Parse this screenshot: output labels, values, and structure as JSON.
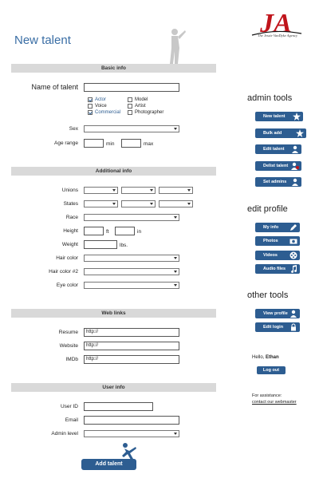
{
  "page": {
    "title": "New talent"
  },
  "logo": {
    "monogram": "JA",
    "tagline": "The Jessie VanDyke Agency"
  },
  "sections": {
    "basic": "Basic info",
    "additional": "Additional info",
    "web": "Web links",
    "user": "User info"
  },
  "basic": {
    "name_label": "Name of talent",
    "roles": [
      {
        "label": "Actor",
        "checked": true
      },
      {
        "label": "Model",
        "checked": false
      },
      {
        "label": "Voice",
        "checked": false
      },
      {
        "label": "Artist",
        "checked": false
      },
      {
        "label": "Commercial",
        "checked": true
      },
      {
        "label": "Photographer",
        "checked": false
      }
    ],
    "sex_label": "Sex",
    "age_label": "Age range",
    "age_min": "min",
    "age_max": "max"
  },
  "additional": {
    "unions": "Unions",
    "states": "States",
    "race": "Race",
    "height": "Height",
    "height_ft": "ft",
    "height_in": "in",
    "weight": "Weight",
    "weight_unit": "lbs.",
    "hair": "Hair color",
    "hair2": "Hair color #2",
    "eye": "Eye color"
  },
  "web": {
    "resume": "Resume",
    "website": "Website",
    "imdb": "IMDb",
    "prefix": "http://"
  },
  "user": {
    "userid": "User ID",
    "email": "Email",
    "admin": "Admin level"
  },
  "submit": "Add talent",
  "sidebar": {
    "admin_heading": "admin tools",
    "admin_buttons": [
      "New talent",
      "Bulk add",
      "Edit talent",
      "Delist talent",
      "Set admins"
    ],
    "profile_heading": "edit profile",
    "profile_buttons": [
      "My info",
      "Photos",
      "Videos",
      "Audio files"
    ],
    "other_heading": "other tools",
    "other_buttons": [
      "View profile",
      "Edit login"
    ],
    "hello_prefix": "Hello,",
    "user_name": "Ethan",
    "logout": "Log out",
    "assist": "For assistance:",
    "assist_link": "contact our webmaster"
  },
  "colors": {
    "accent": "#2d5d91",
    "title": "#3a6ea5",
    "section_bg": "#d9d9d9"
  }
}
